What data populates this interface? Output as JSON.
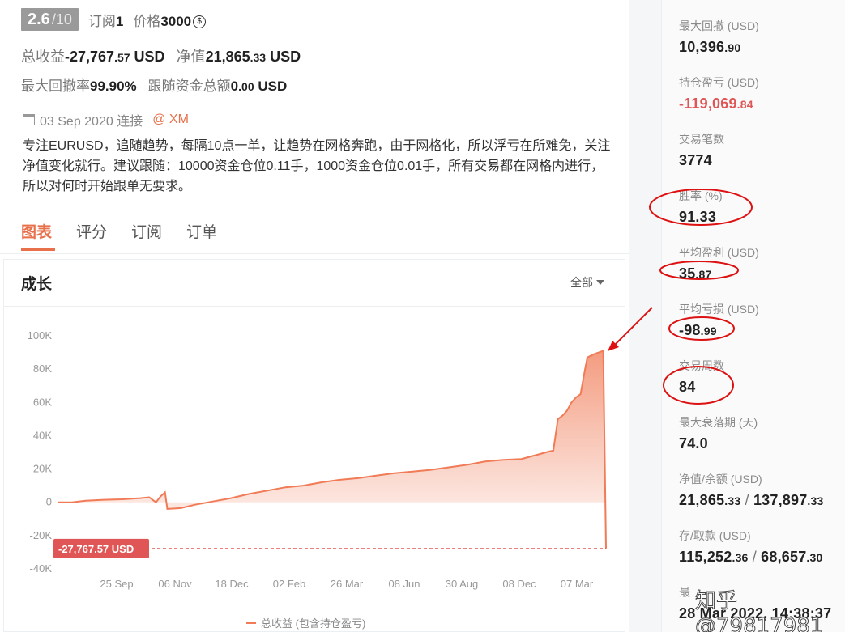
{
  "header": {
    "score": "2.6",
    "score_max": "/10",
    "subscribe_label": "订阅",
    "subscribe_count": "1",
    "price_label": "价格",
    "price_value": "3000",
    "price_icon": "coin-icon"
  },
  "summary": {
    "total_profit_label": "总收益",
    "total_profit_int": "-27,767",
    "total_profit_dec": ".57",
    "total_profit_unit": "USD",
    "equity_label": "净值",
    "equity_int": "21,865",
    "equity_dec": ".33",
    "equity_unit": "USD",
    "max_dd_rate_label": "最大回撤率",
    "max_dd_rate": "99.90%",
    "follow_total_label": "跟随资金总额",
    "follow_total_int": "0",
    "follow_total_dec": ".00",
    "follow_total_unit": "USD"
  },
  "since": {
    "date": "03 Sep 2020 连接",
    "broker": "@ XM"
  },
  "description": "专注EURUSD，追随趋势，每隔10点一单，让趋势在网格奔跑，由于网格化，所以浮亏在所难免，关注净值变化就行。建议跟随：10000资金仓位0.11手，1000资金仓位0.01手，所有交易都在网格内进行，所以对何时开始跟单无要求。",
  "tabs": [
    "图表",
    "评分",
    "订阅",
    "订单"
  ],
  "chart_section": {
    "title": "成长",
    "range": "全部",
    "current_label": "-27,767.57 USD",
    "legend": "总收益 (包含持仓盈亏)"
  },
  "chart_data": {
    "type": "area",
    "y_ticks": [
      "100K",
      "80K",
      "60K",
      "40K",
      "20K",
      "0",
      "-20K",
      "-40K"
    ],
    "ylim": [
      -40000,
      100000
    ],
    "x_ticks": [
      "25 Sep",
      "06 Nov",
      "18 Dec",
      "02 Feb",
      "26 Mar",
      "08 Jun",
      "30 Aug",
      "08 Dec",
      "07 Mar"
    ],
    "grid": false,
    "series": [
      {
        "name": "总收益 (包含持仓盈亏)",
        "color": "#f07b56",
        "points": [
          [
            0,
            0
          ],
          [
            3,
            0
          ],
          [
            6,
            1000
          ],
          [
            10,
            1500
          ],
          [
            14,
            1800
          ],
          [
            18,
            2500
          ],
          [
            20,
            3000
          ],
          [
            21.5,
            0
          ],
          [
            22.5,
            3500
          ],
          [
            23.5,
            6000
          ],
          [
            24,
            -4000
          ],
          [
            27,
            -3500
          ],
          [
            30,
            -1500
          ],
          [
            34,
            500
          ],
          [
            38,
            2500
          ],
          [
            42,
            5000
          ],
          [
            46,
            7000
          ],
          [
            50,
            9000
          ],
          [
            54,
            10000
          ],
          [
            58,
            12000
          ],
          [
            62,
            13500
          ],
          [
            66,
            14500
          ],
          [
            70,
            16000
          ],
          [
            74,
            17500
          ],
          [
            78,
            18500
          ],
          [
            82,
            19500
          ],
          [
            86,
            21000
          ],
          [
            90,
            22500
          ],
          [
            94,
            24500
          ],
          [
            98,
            25500
          ],
          [
            102,
            26000
          ],
          [
            104,
            27500
          ],
          [
            106,
            29000
          ],
          [
            108,
            30500
          ],
          [
            109,
            31000
          ],
          [
            110,
            50000
          ],
          [
            111,
            52000
          ],
          [
            112,
            55000
          ],
          [
            113,
            60000
          ],
          [
            114,
            63000
          ],
          [
            115,
            65000
          ],
          [
            116,
            80000
          ],
          [
            116.5,
            87000
          ],
          [
            118,
            89000
          ],
          [
            119,
            90000
          ],
          [
            120,
            91000
          ],
          [
            120.6,
            -27767.57
          ]
        ]
      }
    ]
  },
  "stats": [
    {
      "label": "最大回撤 (USD)",
      "int": "10,396",
      "dec": ".90",
      "neg": false
    },
    {
      "label": "持仓盈亏 (USD)",
      "int": "-119,069",
      "dec": ".84",
      "neg": true
    },
    {
      "label": "交易笔数",
      "int": "3774",
      "dec": "",
      "neg": false
    },
    {
      "label": "胜率 (%)",
      "int": "91.33",
      "dec": "",
      "neg": false
    },
    {
      "label": "平均盈利 (USD)",
      "int": "35",
      "dec": ".87",
      "neg": false
    },
    {
      "label": "平均亏损 (USD)",
      "int": "-98",
      "dec": ".99",
      "neg": false
    },
    {
      "label": "交易周数",
      "int": "84",
      "dec": "",
      "neg": false
    },
    {
      "label": "最大衰落期 (天)",
      "int": "74.0",
      "dec": "",
      "neg": false
    },
    {
      "label": "净值/余额 (USD)",
      "int": "21,865",
      "dec": ".33",
      "sep": " / ",
      "int2": "137,897",
      "dec2": ".33",
      "neg": false
    },
    {
      "label": "存/取款 (USD)",
      "int": "115,252",
      "dec": ".36",
      "sep": " / ",
      "int2": "68,657",
      "dec2": ".30",
      "neg": false
    },
    {
      "label": "最",
      "int": "28 Mar 2022, 14:38:37",
      "dec": "",
      "neg": false
    }
  ],
  "watermark": "知乎 @79817981"
}
